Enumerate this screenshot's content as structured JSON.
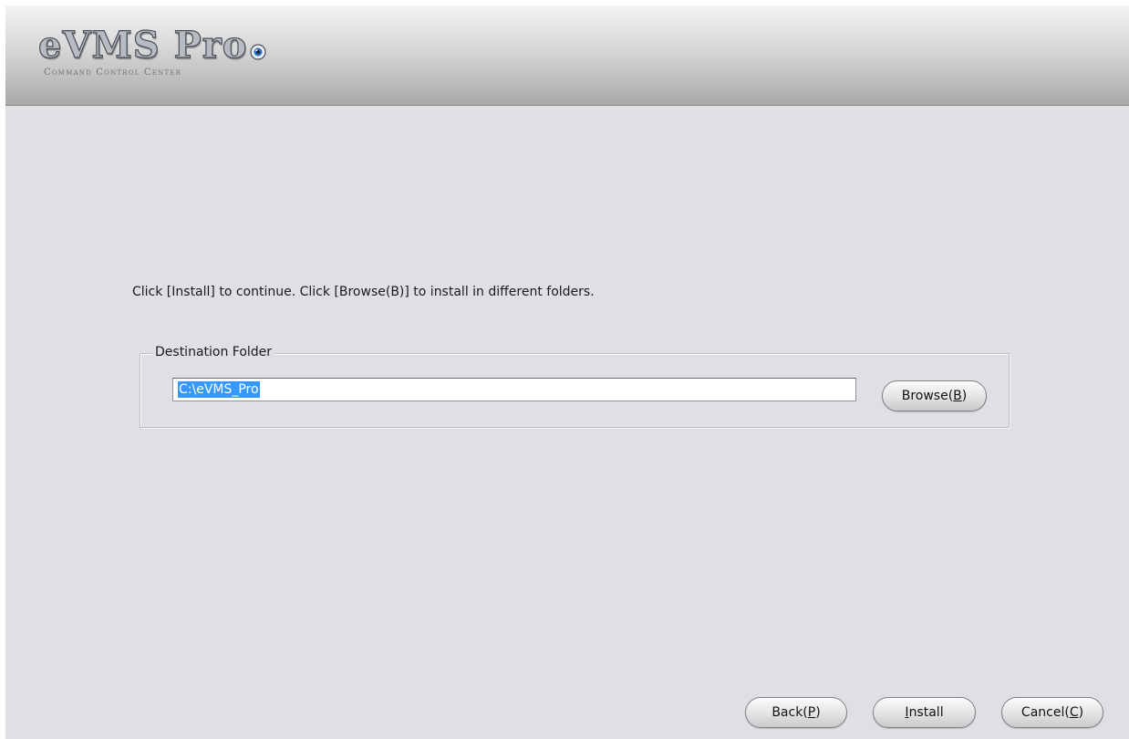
{
  "header": {
    "logo_title": "eVMS Pro",
    "logo_subtitle": "Command Control Center"
  },
  "main": {
    "instruction": "Click [Install] to continue. Click [Browse(B)] to install in different folders.",
    "destination_group": {
      "legend": "Destination Folder",
      "path_value": "C:\\eVMS_Pro",
      "browse_button": {
        "label_prefix": "Browse(",
        "mnemonic": "B",
        "label_suffix": ")"
      }
    }
  },
  "footer": {
    "back_button": {
      "label_prefix": "Back(",
      "mnemonic": "P",
      "label_suffix": ")"
    },
    "install_button": {
      "mnemonic": "I",
      "label_suffix": "nstall"
    },
    "cancel_button": {
      "label_prefix": "Cancel(",
      "mnemonic": "C",
      "label_suffix": ")"
    }
  },
  "colors": {
    "window_background": "#dee0e4",
    "selection_highlight": "#3399ff",
    "header_gradient_top": "#f3f3f3",
    "header_gradient_bottom": "#a9a9a9"
  },
  "icons": {
    "logo_eye": "eye-lens-icon"
  }
}
